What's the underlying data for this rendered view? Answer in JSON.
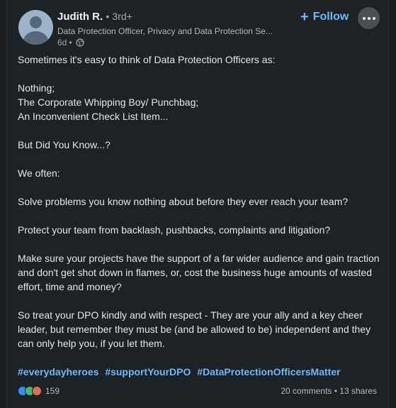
{
  "author": {
    "name": "Judith R.",
    "separator": "•",
    "degree": "3rd+",
    "headline": "Data Protection Officer, Privacy and Data Protection Se...",
    "age": "6d",
    "meta_separator": "•",
    "visibility_icon": "globe-icon"
  },
  "actions": {
    "follow_icon": "+",
    "follow_label": "Follow",
    "more_icon": "more-options-icon"
  },
  "post": {
    "lines": {
      "l1": "Sometimes it's easy to think of Data Protection Officers as:",
      "l2": "Nothing;",
      "l3": "The Corporate Whipping Boy/ Punchbag;",
      "l4": "An Inconvenient Check List Item...",
      "l5": "But Did You Know...?",
      "l6": "We often:",
      "l7": "Solve problems you know nothing about before they ever reach your team?",
      "l8": "Protect your team from backlash, pushbacks, complaints and litigation?",
      "l9": "Make sure your projects have the support of a far wider audience and gain traction and don't get shot down in flames, or, cost the business huge amounts of wasted effort, time and money?",
      "l10": "So treat your DPO kindly and with respect - They are your ally and a key cheer leader, but remember they must be (and be allowed to be) independent and they can only help you, if you let them."
    },
    "hashtags": [
      "#everydayheroes",
      "#supportYourDPO",
      "#DataProtectionOfficersMatter"
    ]
  },
  "social": {
    "reaction_icons": [
      "like-icon",
      "celebrate-icon",
      "love-icon"
    ],
    "reaction_count": "159",
    "comments": "20 comments",
    "stats_separator": "•",
    "shares": "13 shares"
  },
  "colors": {
    "background": "#1d2226",
    "link_blue": "#71b7fb",
    "text": "#e6e6e6",
    "muted": "#a8a8a8"
  }
}
